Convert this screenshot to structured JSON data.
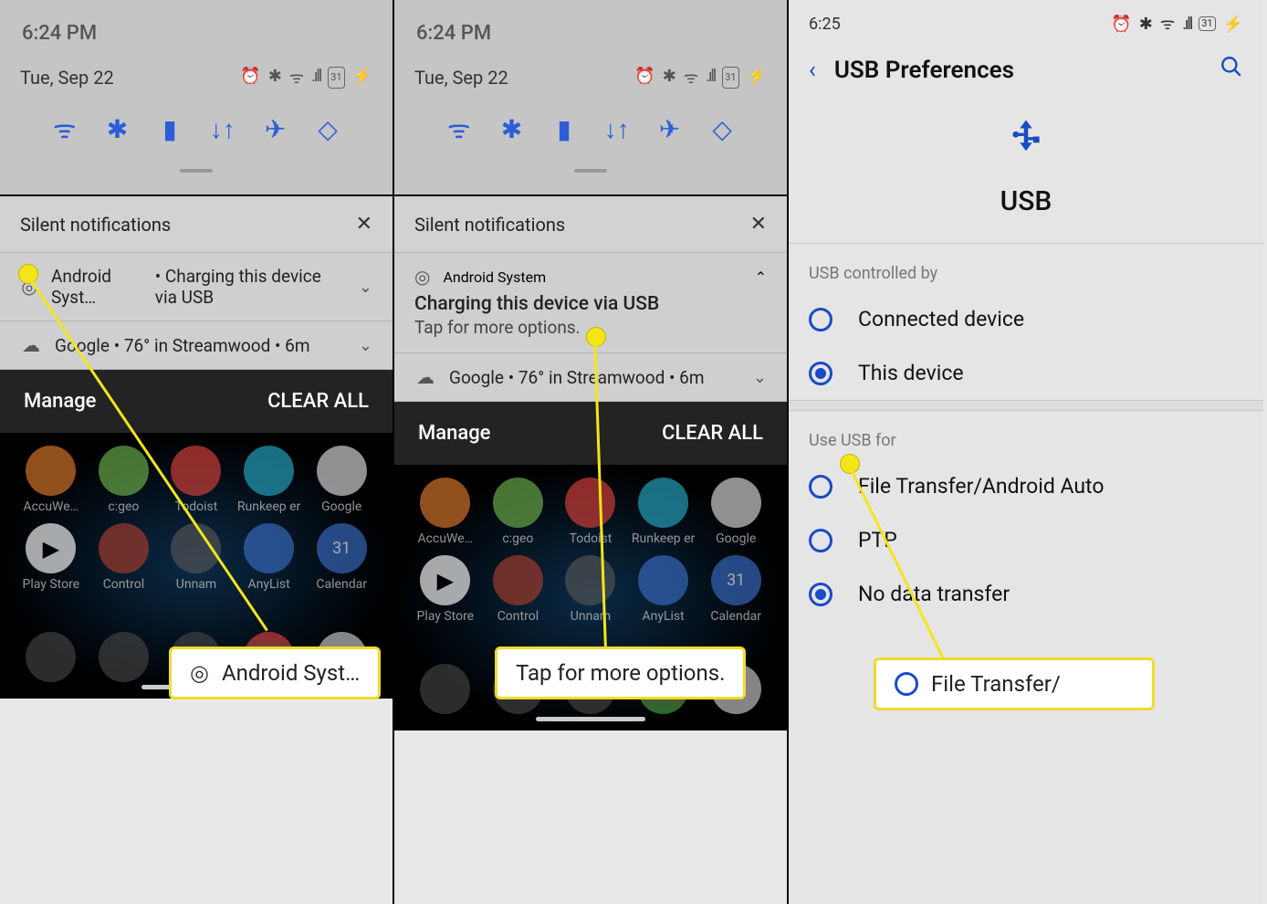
{
  "panel1": {
    "status_time": "6:24 PM",
    "shade_date": "Tue, Sep 22",
    "status_icons": {
      "alarm": "⏰",
      "bt": "✱",
      "wifi": "ᯤ",
      "signal": ".ıll",
      "battery": "31"
    },
    "silent_header": "Silent notifications",
    "notif_android": "Android Syst…",
    "notif_charging": "• Charging this device via USB",
    "notif_google": "Google • 76° in Streamwood • 6m",
    "manage": "Manage",
    "clear_all": "CLEAR ALL",
    "apps_row1": [
      "AccuWe…",
      "c:geo",
      "Todoist",
      "Runkeep\ner",
      "Google"
    ],
    "apps_row2": [
      "Play\nStore",
      "Control",
      "Unnam",
      "AnyList",
      "Calendar"
    ],
    "callout": "Android Syst…"
  },
  "panel2": {
    "status_time": "6:24 PM",
    "shade_date": "Tue, Sep 22",
    "silent_header": "Silent notifications",
    "notif_android_full": "Android System",
    "notif_charging_title": "Charging this device via USB",
    "notif_charging_sub": "Tap for more options.",
    "notif_google": "Google • 76° in Streamwood • 6m",
    "manage": "Manage",
    "clear_all": "CLEAR ALL",
    "apps_row1": [
      "AccuWe…",
      "c:geo",
      "Todoist",
      "Runkeep\ner",
      "Google"
    ],
    "apps_row2": [
      "Play\nStore",
      "Control",
      "Unnam",
      "AnyList",
      "Calendar"
    ],
    "callout": "Tap for more options."
  },
  "panel3": {
    "status_time": "6:25",
    "status_icons": {
      "alarm": "⏰",
      "bt": "✱",
      "wifi": "ᯤ",
      "signal": ".ıll",
      "battery": "31"
    },
    "title": "USB Preferences",
    "usb_label": "USB",
    "section1": "USB controlled by",
    "opt_connected": "Connected device",
    "opt_this": "This device",
    "section2": "Use USB for",
    "opt_file": "File Transfer/Android Auto",
    "opt_ptp": "PTP",
    "opt_nodata": "No data transfer",
    "callout": "File Transfer/"
  }
}
